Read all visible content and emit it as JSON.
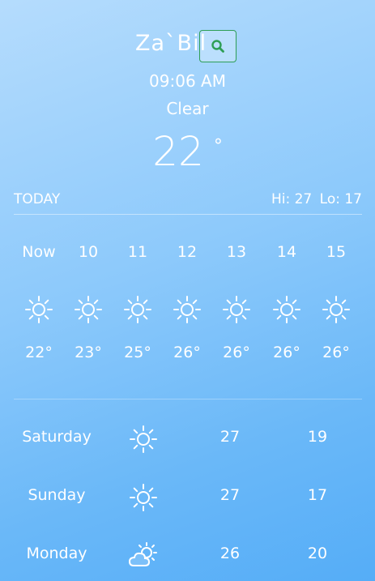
{
  "header": {
    "city": "Za`Bil",
    "time": "09:06 AM",
    "condition": "Clear",
    "temperature": "22",
    "temperature_unit": "°"
  },
  "today": {
    "label": "TODAY",
    "hi": "Hi: 27",
    "lo": "Lo: 17"
  },
  "hourly": [
    {
      "label": "Now",
      "icon": "sun-icon",
      "temp": "22°"
    },
    {
      "label": "10",
      "icon": "sun-icon",
      "temp": "23°"
    },
    {
      "label": "11",
      "icon": "sun-icon",
      "temp": "25°"
    },
    {
      "label": "12",
      "icon": "sun-icon",
      "temp": "26°"
    },
    {
      "label": "13",
      "icon": "sun-icon",
      "temp": "26°"
    },
    {
      "label": "14",
      "icon": "sun-icon",
      "temp": "26°"
    },
    {
      "label": "15",
      "icon": "sun-icon",
      "temp": "26°"
    }
  ],
  "daily": [
    {
      "day": "Saturday",
      "icon": "sun-icon",
      "hi": "27",
      "lo": "19"
    },
    {
      "day": "Sunday",
      "icon": "sun-icon",
      "hi": "27",
      "lo": "17"
    },
    {
      "day": "Monday",
      "icon": "partly-cloudy-icon",
      "hi": "26",
      "lo": "20"
    }
  ],
  "colors": {
    "background_top": "#b5dcfd",
    "background_bottom": "#55adf7",
    "search_accent": "#2e9e55",
    "text": "#ffffff"
  }
}
